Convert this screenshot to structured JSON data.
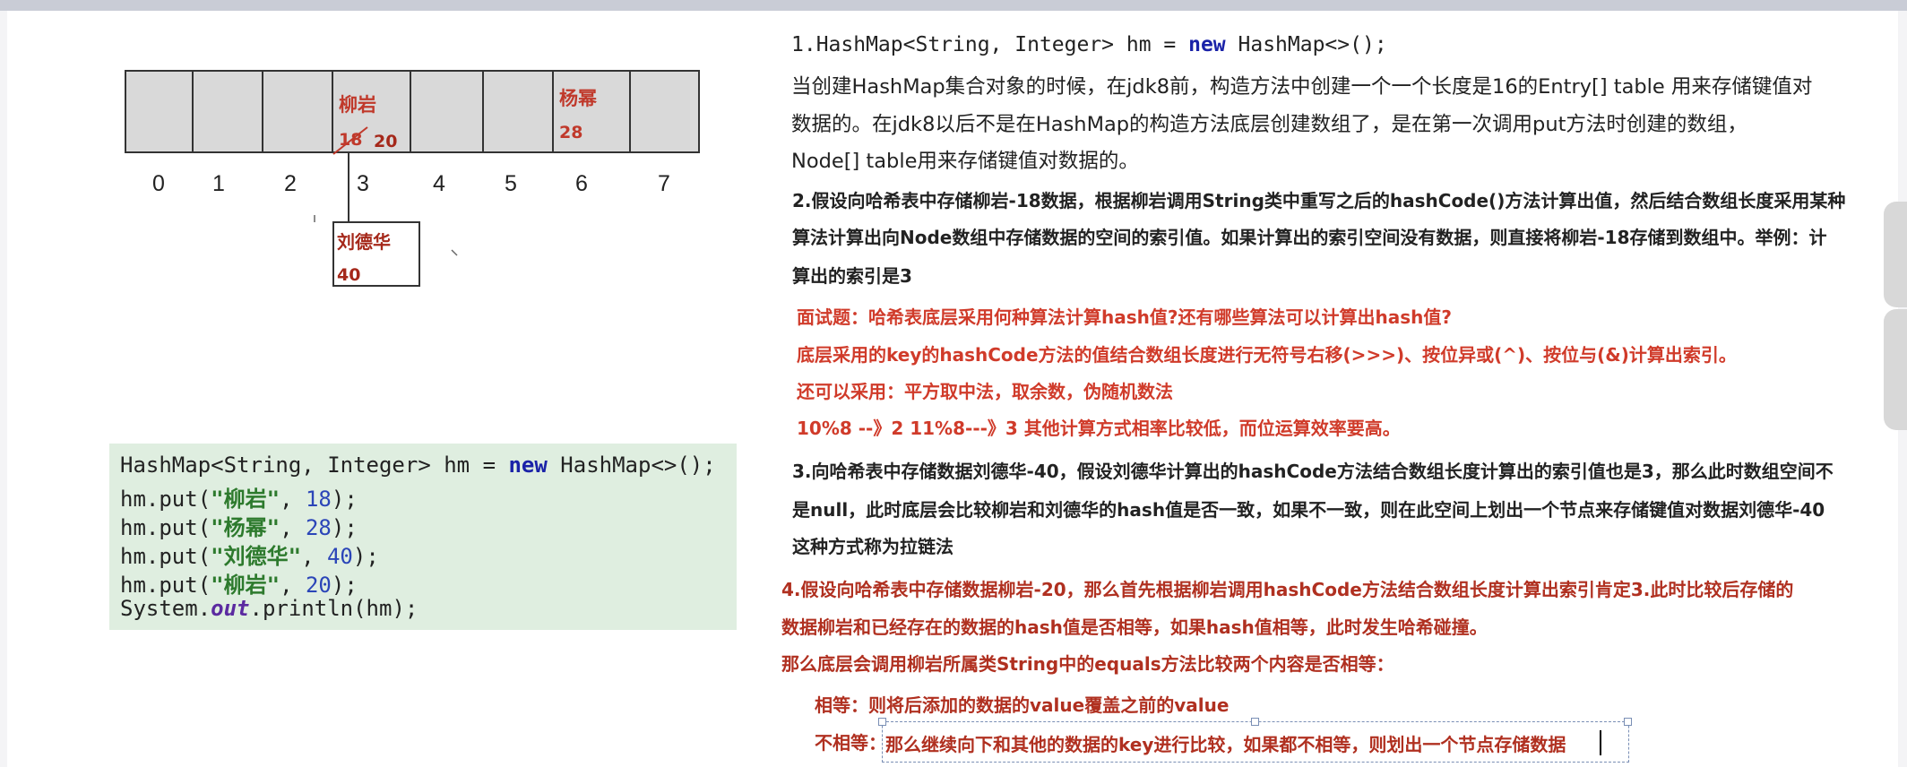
{
  "diagram": {
    "indices": [
      "0",
      "1",
      "2",
      "3",
      "4",
      "5",
      "6",
      "7"
    ],
    "slot3": {
      "key": "柳岩",
      "old_value": "18",
      "new_value": "20"
    },
    "slot6": {
      "key": "杨幂",
      "value": "28"
    },
    "linked_node": {
      "key": "刘德华",
      "value": "40"
    }
  },
  "code": {
    "line1": {
      "text_a": "HashMap<String, Integer> hm = ",
      "kw": "new",
      "text_b": " HashMap<>();"
    },
    "line2": {
      "prefix": "hm.put(",
      "str": "\"柳岩\"",
      "sep": ", ",
      "num": "18",
      "suffix": ");"
    },
    "line3": {
      "prefix": "hm.put(",
      "str": "\"杨幂\"",
      "sep": ", ",
      "num": "28",
      "suffix": ");"
    },
    "line4": {
      "prefix": "hm.put(",
      "str": "\"刘德华\"",
      "sep": ", ",
      "num": "40",
      "suffix": ");"
    },
    "line5": {
      "prefix": "hm.put(",
      "str": "\"柳岩\"",
      "sep": ", ",
      "num": "20",
      "suffix": ");"
    },
    "line6": {
      "prefix": "System.",
      "field": "out",
      "suffix": ".println(hm);"
    }
  },
  "notes": {
    "p1_code_a": "1.HashMap<String, Integer> hm = ",
    "p1_code_kw": "new",
    "p1_code_b": " HashMap<>();",
    "p1_l2": "当创建HashMap集合对象的时候，在jdk8前，构造方法中创建一个一个长度是16的Entry[] table 用来存储键值对",
    "p1_l3": "数据的。在jdk8以后不是在HashMap的构造方法底层创建数组了，是在第一次调用put方法时创建的数组，",
    "p1_l4": "Node[] table用来存储键值对数据的。",
    "p2_l1": "2.假设向哈希表中存储柳岩-18数据，根据柳岩调用String类中重写之后的hashCode()方法计算出值，然后结合数组长度采用某种",
    "p2_l2": "算法计算出向Node数组中存储数据的空间的索引值。如果计算出的索引空间没有数据，则直接将柳岩-18存储到数组中。举例：计",
    "p2_l3": "算出的索引是3",
    "q_l1": "面试题：哈希表底层采用何种算法计算hash值?还有哪些算法可以计算出hash值?",
    "q_l2": "底层采用的key的hashCode方法的值结合数组长度进行无符号右移(>>>)、按位异或(^)、按位与(&)计算出索引。",
    "q_l3": "还可以采用：平方取中法，取余数，伪随机数法",
    "q_l4": "10%8 --》2  11%8---》3 其他计算方式相率比较低，而位运算效率要高。",
    "p3_l1": "3.向哈希表中存储数据刘德华-40，假设刘德华计算出的hashCode方法结合数组长度计算出的索引值也是3，那么此时数组空间不",
    "p3_l2": "是null，此时底层会比较柳岩和刘德华的hash值是否一致，如果不一致，则在此空间上划出一个节点来存储键值对数据刘德华-40",
    "p3_l3": "这种方式称为拉链法",
    "p4_l1": "4.假设向哈希表中存储数据柳岩-20，那么首先根据柳岩调用hashCode方法结合数组长度计算出索引肯定3.此时比较后存储的",
    "p4_l2": "数据柳岩和已经存在的数据的hash值是否相等，如果hash值相等，此时发生哈希碰撞。",
    "p4_l3": "那么底层会调用柳岩所属类String中的equals方法比较两个内容是否相等：",
    "eq_label": "相等：",
    "eq_text": "则将后添加的数据的value覆盖之前的value",
    "neq_label": "不相等：",
    "neq_text": "那么继续向下和其他的数据的key进行比较，如果都不相等，则划出一个节点存储数据"
  }
}
